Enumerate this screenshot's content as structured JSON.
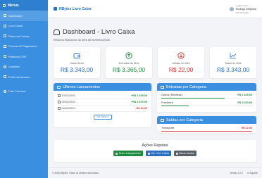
{
  "sidebar": {
    "title": "Menus",
    "items": [
      {
        "label": "Dashboard"
      },
      {
        "label": "Livro Caixa"
      },
      {
        "label": "Plano de Contas"
      },
      {
        "label": "Formas de Pagamento"
      },
      {
        "label": "Relatório DRE"
      },
      {
        "label": "Usuários"
      },
      {
        "label": "Perfis de Acesso"
      },
      {
        "label": "Fale Conosco"
      }
    ]
  },
  "topbar": {
    "brand": "RBytes Livro Caixa",
    "user_caption": "Logado como",
    "user_name": "Rodrigo Delphino",
    "user_role": "Administrador"
  },
  "page": {
    "title": "Dashboard - Livro Caixa",
    "subtitle": "Resumo financeiro do mês de fevereiro/2026"
  },
  "cards": [
    {
      "label": "Saldo Atual",
      "value": "R$ 3.343,00",
      "color": "#2a6fc0",
      "icon": "wallet-icon"
    },
    {
      "label": "Entradas do Mês",
      "value": "R$ 3.365,00",
      "color": "#1e8a3e",
      "icon": "arrow-up-icon"
    },
    {
      "label": "Saídas do Mês",
      "value": "R$ 22,00",
      "color": "#d9322f",
      "icon": "arrow-down-icon"
    },
    {
      "label": "Saldo do Mês",
      "value": "R$ 3.343,00",
      "color": "#2a6fc0",
      "icon": "chart-line-icon"
    }
  ],
  "transactions": {
    "title": "Últimos Lançamentos",
    "rows": [
      {
        "date": "10/02/2026 -",
        "amount": "+R$ 2.345,00",
        "type": "in"
      },
      {
        "date": "05/02/2026 -",
        "amount": "+R$ 1.020,00",
        "type": "in"
      },
      {
        "date": "04/02/2026 -",
        "amount": "-R$ 22,00",
        "type": "out"
      }
    ],
    "more_label": "Ver Todos"
  },
  "income_categories": {
    "title": "Entradas por Categoria",
    "items": [
      {
        "name": "Outros (Receitas)",
        "amount": "R$ 2.345,00",
        "fraction": 0.697
      },
      {
        "name": "Freelance",
        "amount": "R$ 1.020,00",
        "fraction": 0.303
      }
    ]
  },
  "expense_categories": {
    "title": "Saídas por Categoria",
    "items": [
      {
        "name": "Transporte",
        "amount": "R$ 22,00",
        "fraction": 1.0
      }
    ]
  },
  "quick_actions": {
    "title": "Ações Rápidas",
    "buttons": [
      {
        "label": "Novo Lançamento",
        "color": "#1e8a3e"
      },
      {
        "label": "Ver Livro Caixa",
        "color": "#2a6fc0"
      },
      {
        "label": "Meus Dados",
        "color": "#5a6068"
      }
    ]
  },
  "footer": {
    "copyright": "© 2026 RBytes. Todos os direitos reservados.",
    "version": "Versão 1.0.0",
    "support": "Suporte"
  },
  "colors": {
    "income": "#1e8a3e",
    "expense": "#d9322f",
    "accent": "#3a8fe0"
  }
}
